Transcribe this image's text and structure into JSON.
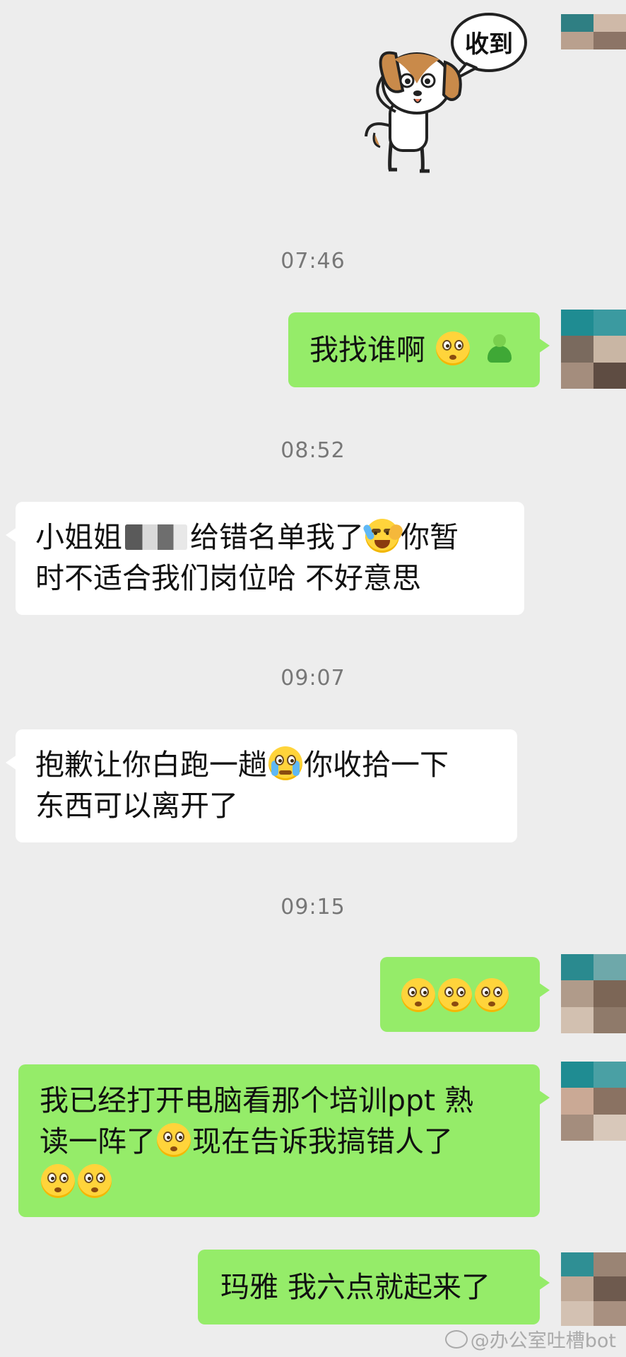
{
  "chat": {
    "sticker_text": "收到",
    "timestamps": [
      "07:46",
      "08:52",
      "09:07",
      "09:15"
    ],
    "messages": [
      {
        "side": "sent",
        "text": "我找谁啊"
      },
      {
        "side": "received",
        "line1_a": "小姐姐",
        "line1_b": "给错名单我了",
        "line1_c": "你暂",
        "line2": "时不适合我们岗位哈 不好意思"
      },
      {
        "side": "received",
        "line1_a": "抱歉让你白跑一趟",
        "line1_b": "你收拾一下",
        "line2": "东西可以离开了"
      },
      {
        "side": "sent",
        "emojis": [
          "flushed-emoji",
          "flushed-emoji",
          "flushed-emoji"
        ]
      },
      {
        "side": "sent",
        "line1": "我已经打开电脑看那个培训ppt 熟",
        "line2_a": "读一阵了",
        "line2_b": "现在告诉我搞错人了"
      },
      {
        "side": "sent",
        "text": "玛雅 我六点就起来了"
      }
    ]
  },
  "watermark": "@办公室吐槽bot",
  "colors": {
    "background": "#ededed",
    "sent_bubble": "#95ec69",
    "received_bubble": "#ffffff",
    "timestamp": "#777777"
  }
}
